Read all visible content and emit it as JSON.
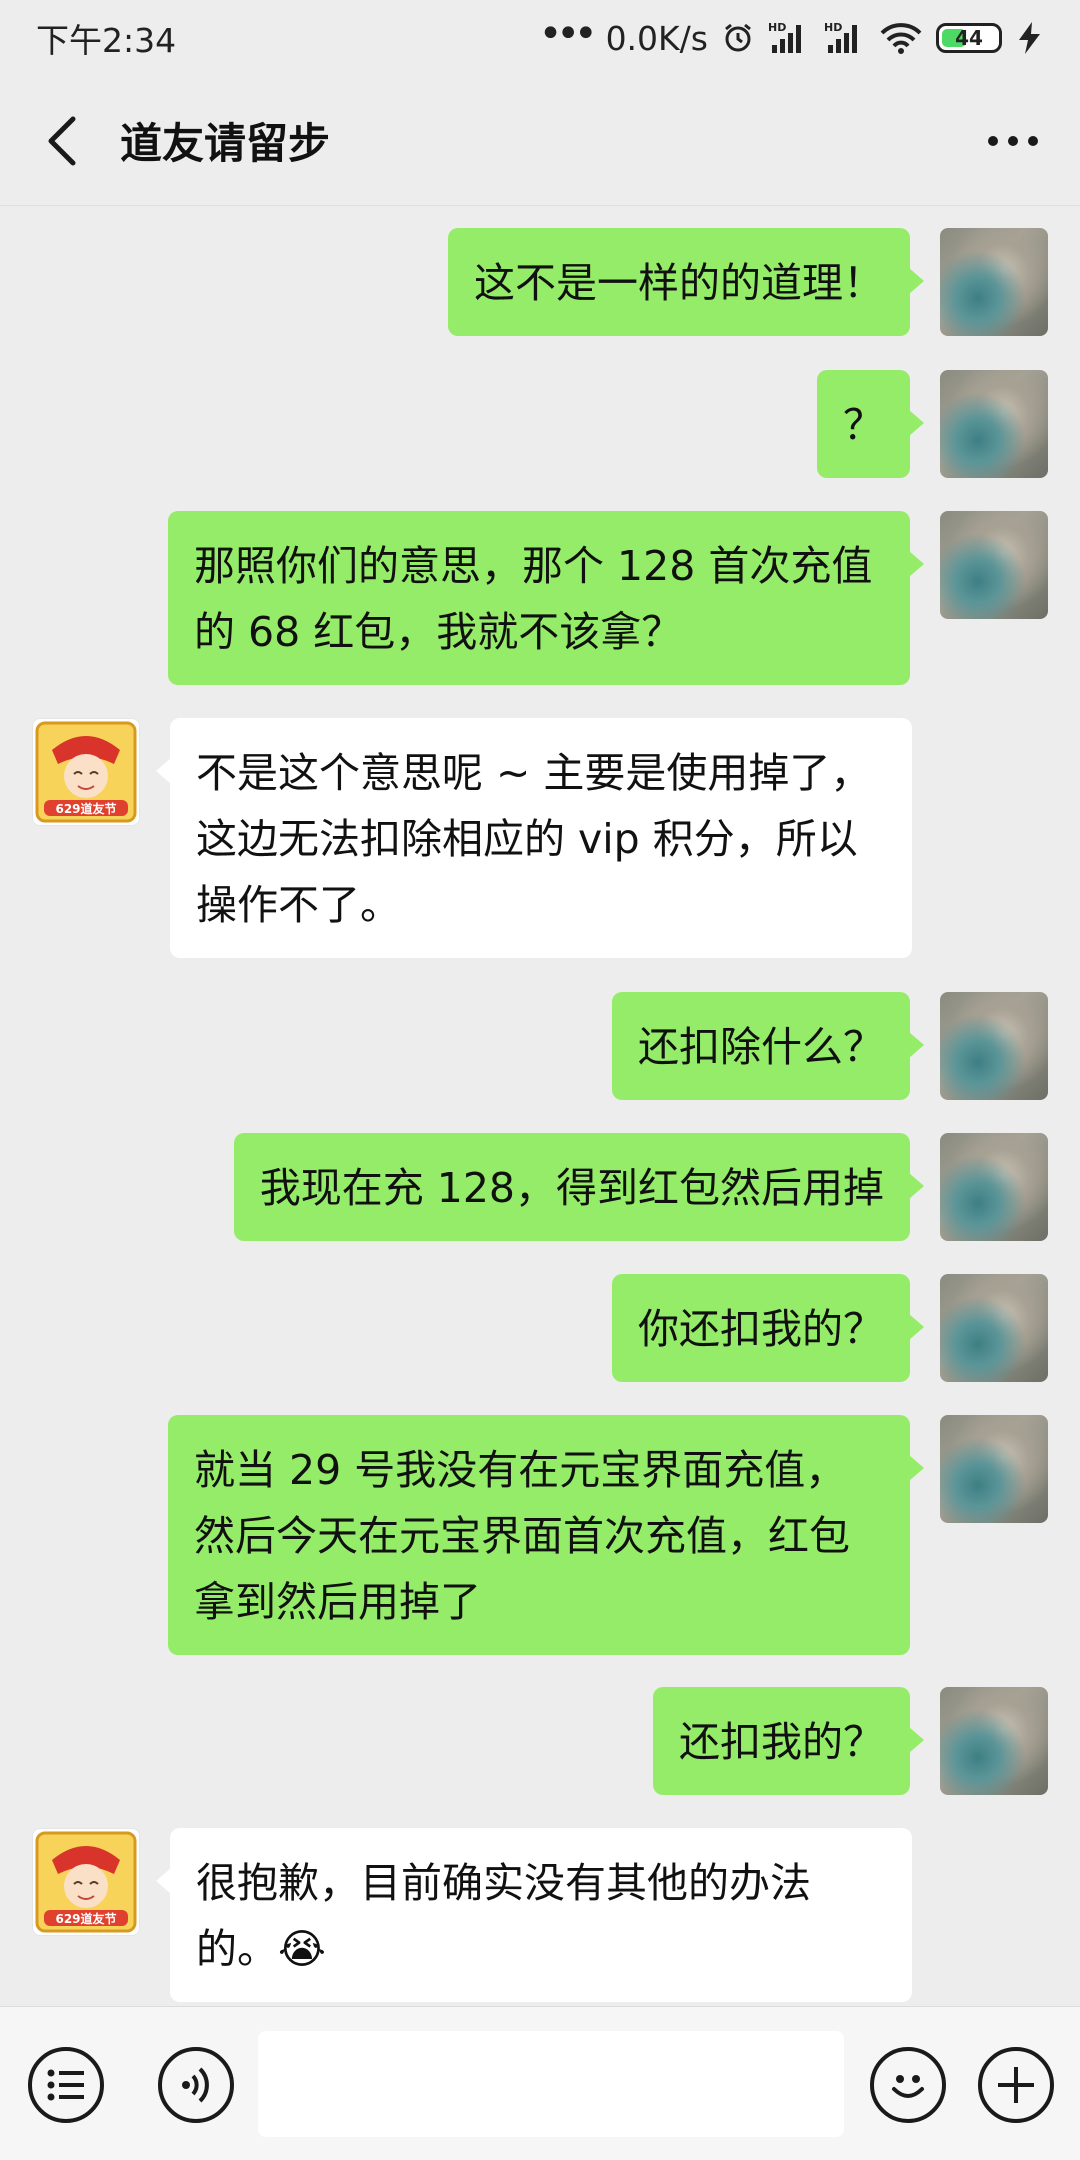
{
  "status_bar": {
    "time": "下午2:34",
    "network_speed": "0.0K/s",
    "battery_level": "44",
    "signal_label": "HD",
    "icons": [
      "more-dots-icon",
      "alarm-icon",
      "signal-hd-icon",
      "signal-hd-icon",
      "wifi-icon",
      "battery-icon",
      "charging-icon"
    ]
  },
  "header": {
    "title": "道友请留步",
    "back_icon": "chevron-left-icon",
    "more_icon": "more-horizontal-icon"
  },
  "messages": [
    {
      "side": "right",
      "text": "这不是一样的的道理！"
    },
    {
      "side": "right",
      "text": "？"
    },
    {
      "side": "right",
      "text": "那照你们的意思，那个 128 首次充值的 68 红包，我就不该拿？"
    },
    {
      "side": "left",
      "text": "不是这个意思呢 ~ 主要是使用掉了，这边无法扣除相应的 vip 积分，所以操作不了。",
      "avatar_badge": "629道友节"
    },
    {
      "side": "right",
      "text": "还扣除什么？"
    },
    {
      "side": "right",
      "text": "我现在充 128，得到红包然后用掉"
    },
    {
      "side": "right",
      "text": "你还扣我的？"
    },
    {
      "side": "right",
      "text": "就当 29 号我没有在元宝界面充值，然后今天在元宝界面首次充值，红包拿到然后用掉了"
    },
    {
      "side": "right",
      "text": "还扣我的？"
    },
    {
      "side": "left",
      "text": "很抱歉，目前确实没有其他的办法的。",
      "emoji": "😭",
      "avatar_badge": "629道友节"
    }
  ],
  "input_bar": {
    "list_icon": "list-menu-icon",
    "voice_icon": "voice-icon",
    "input_value": "",
    "emoji_icon": "emoji-icon",
    "plus_icon": "plus-icon"
  },
  "colors": {
    "background": "#ededed",
    "self_bubble": "#95ec69",
    "other_bubble": "#ffffff",
    "input_bar": "#f6f6f6"
  }
}
